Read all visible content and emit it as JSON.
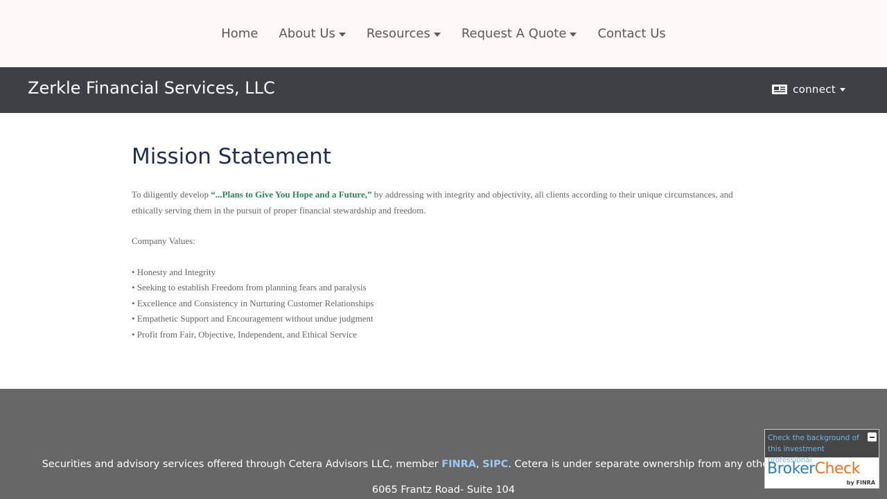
{
  "nav": {
    "items": [
      {
        "label": "Home",
        "has_caret": false
      },
      {
        "label": "About Us",
        "has_caret": true
      },
      {
        "label": "Resources",
        "has_caret": true
      },
      {
        "label": "Request A Quote",
        "has_caret": true
      },
      {
        "label": "Contact Us",
        "has_caret": false
      }
    ]
  },
  "header": {
    "brand": "Zerkle Financial Services, LLC",
    "connect_label": "connect",
    "connect_icon": "newspaper-icon"
  },
  "main": {
    "title": "Mission Statement",
    "mission_before": "To diligently develop ",
    "mission_emphasis": "“...Plans to Give You Hope and a Future,”",
    "mission_after": " by addressing with integrity and objectivity, all clients according to their unique circumstances, and ethically serving them in the pursuit of proper financial stewardship and freedom.",
    "values_heading": "Company Values:",
    "values": [
      "• Honesty and Integrity",
      "• Seeking to establish Freedom from planning fears and paralysis",
      "• Excellence and Consistency in Nurturing Customer Relationships",
      "• Empathetic Support and Encouragement without undue judgment",
      "• Profit from Fair, Objective, Independent, and Ethical Service"
    ]
  },
  "footer": {
    "disclaimer_before": "Securities and advisory services offered through Cetera Advisors LLC, member ",
    "finra": "FINRA",
    "comma": ", ",
    "sipc": "SIPC",
    "disclaimer_after": ". Cetera is under separate ownership from any other named entity.",
    "address": "6065 Frantz Road- Suite 104"
  },
  "brokercheck": {
    "text": "Check the background of this investment professional",
    "brand_broker": "Broker",
    "brand_check": "Check",
    "by": "by FINRA"
  },
  "colors": {
    "nav_bg": "#fdf8f5",
    "header_bg": "#3d4045",
    "title": "#1f2d50",
    "emphasis": "#2e8a55",
    "footer_bg": "#676767",
    "link": "#9ec9f0"
  }
}
